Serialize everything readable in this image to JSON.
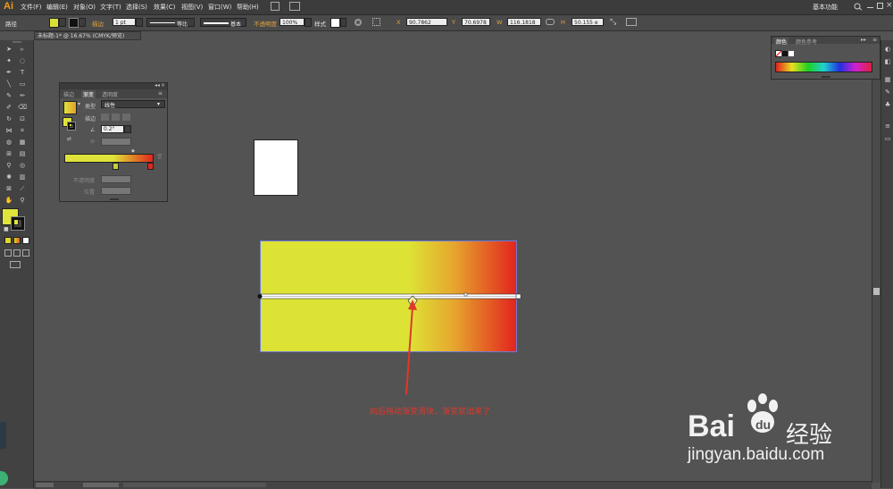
{
  "app": {
    "logo": "Ai"
  },
  "menu": [
    "文件(F)",
    "编辑(E)",
    "对象(O)",
    "文字(T)",
    "选择(S)",
    "效果(C)",
    "视图(V)",
    "窗口(W)",
    "帮助(H)"
  ],
  "workspace": "基本功能",
  "control_bar": {
    "path_label": "路径",
    "stroke_label": "描边",
    "stroke_weight": "1 pt",
    "profile_label": "等比",
    "brush_label": "基本",
    "opacity_label": "不透明度",
    "opacity_value": "100%",
    "style_label": "样式",
    "x_value": "90.7862",
    "y_value": "70.6978",
    "w_value": "116.1818",
    "h_value": "50.155 e"
  },
  "document_tab": "未标题-1* @ 16.67% (CMYK/预览)",
  "gradient_panel": {
    "tabs": [
      "描边",
      "渐变",
      "透明度"
    ],
    "type_label": "类型",
    "type_value": "线性",
    "stroke_label": "描边",
    "angle_value": "0.2°",
    "opacity_label": "不透明度",
    "position_label": "位置",
    "gradient_start": "#dfe33a",
    "gradient_end": "#e0271f"
  },
  "color_panel": {
    "tabs": [
      "颜色",
      "颜色参考"
    ]
  },
  "canvas": {
    "annotation": "向后拖动渐变滑块，渐变就出来了",
    "colors": {
      "rect_start": "#dde335",
      "rect_end": "#e1251d",
      "arrow": "#e0382b"
    }
  },
  "watermark": {
    "brand": "Bai",
    "brand_cn": "经验",
    "url": "jingyan.baidu.com"
  }
}
